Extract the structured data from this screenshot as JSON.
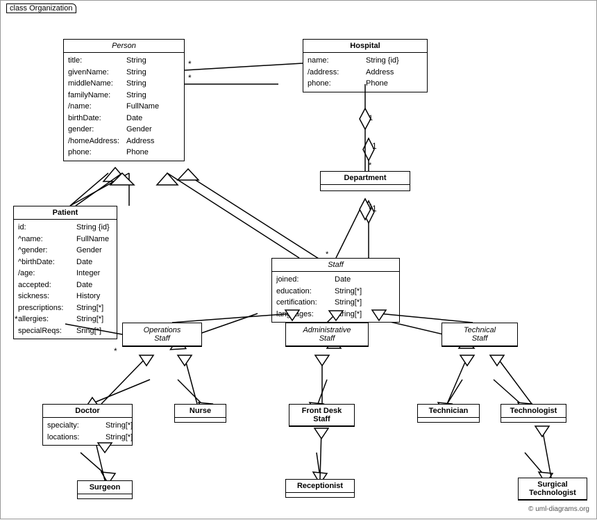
{
  "diagram": {
    "title": "class Organization",
    "classes": {
      "person": {
        "name": "Person",
        "italic": true,
        "attrs": [
          {
            "name": "title:",
            "type": "String"
          },
          {
            "name": "givenName:",
            "type": "String"
          },
          {
            "name": "middleName:",
            "type": "String"
          },
          {
            "name": "familyName:",
            "type": "String"
          },
          {
            "name": "/name:",
            "type": "FullName"
          },
          {
            "name": "birthDate:",
            "type": "Date"
          },
          {
            "name": "gender:",
            "type": "Gender"
          },
          {
            "name": "/homeAddress:",
            "type": "Address"
          },
          {
            "name": "phone:",
            "type": "Phone"
          }
        ]
      },
      "hospital": {
        "name": "Hospital",
        "attrs": [
          {
            "name": "name:",
            "type": "String {id}"
          },
          {
            "name": "/address:",
            "type": "Address"
          },
          {
            "name": "phone:",
            "type": "Phone"
          }
        ]
      },
      "department": {
        "name": "Department",
        "attrs": []
      },
      "patient": {
        "name": "Patient",
        "attrs": [
          {
            "name": "id:",
            "type": "String {id}"
          },
          {
            "name": "^name:",
            "type": "FullName"
          },
          {
            "name": "^gender:",
            "type": "Gender"
          },
          {
            "name": "^birthDate:",
            "type": "Date"
          },
          {
            "name": "/age:",
            "type": "Integer"
          },
          {
            "name": "accepted:",
            "type": "Date"
          },
          {
            "name": "sickness:",
            "type": "History"
          },
          {
            "name": "prescriptions:",
            "type": "String[*]"
          },
          {
            "name": "allergies:",
            "type": "String[*]"
          },
          {
            "name": "specialReqs:",
            "type": "Sring[*]"
          }
        ]
      },
      "staff": {
        "name": "Staff",
        "italic": true,
        "attrs": [
          {
            "name": "joined:",
            "type": "Date"
          },
          {
            "name": "education:",
            "type": "String[*]"
          },
          {
            "name": "certification:",
            "type": "String[*]"
          },
          {
            "name": "languages:",
            "type": "String[*]"
          }
        ]
      },
      "operations_staff": {
        "name": "Operations\nStaff",
        "italic": true,
        "attrs": []
      },
      "administrative_staff": {
        "name": "Administrative\nStaff",
        "italic": true,
        "attrs": []
      },
      "technical_staff": {
        "name": "Technical\nStaff",
        "italic": true,
        "attrs": []
      },
      "doctor": {
        "name": "Doctor",
        "attrs": [
          {
            "name": "specialty:",
            "type": "String[*]"
          },
          {
            "name": "locations:",
            "type": "String[*]"
          }
        ]
      },
      "nurse": {
        "name": "Nurse",
        "attrs": []
      },
      "front_desk_staff": {
        "name": "Front Desk\nStaff",
        "attrs": []
      },
      "technician": {
        "name": "Technician",
        "attrs": []
      },
      "technologist": {
        "name": "Technologist",
        "attrs": []
      },
      "surgeon": {
        "name": "Surgeon",
        "attrs": []
      },
      "receptionist": {
        "name": "Receptionist",
        "attrs": []
      },
      "surgical_technologist": {
        "name": "Surgical\nTechnologist",
        "attrs": []
      }
    },
    "copyright": "© uml-diagrams.org"
  }
}
